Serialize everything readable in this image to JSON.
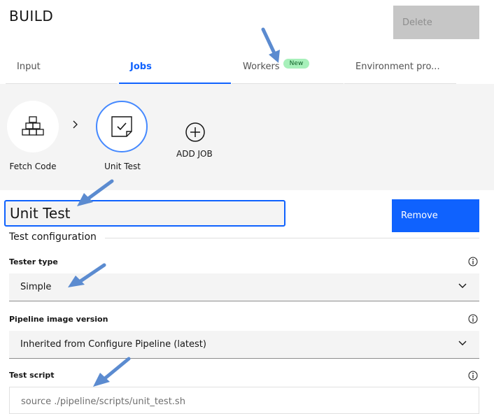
{
  "header": {
    "title": "BUILD",
    "delete_label": "Delete"
  },
  "tabs": [
    {
      "label": "Input",
      "active": false
    },
    {
      "label": "Jobs",
      "active": true
    },
    {
      "label": "Workers",
      "active": false,
      "badge": "New"
    },
    {
      "label": "Environment pro...",
      "active": false
    }
  ],
  "pipeline": {
    "nodes": [
      {
        "label": "Fetch Code",
        "icon": "fetch-code-icon"
      },
      {
        "label": "Unit Test",
        "icon": "unit-test-icon",
        "selected": true
      }
    ],
    "add_job_label": "ADD JOB"
  },
  "job": {
    "name_value": "Unit Test",
    "remove_label": "Remove",
    "section_title": "Test configuration",
    "tester_type": {
      "label": "Tester type",
      "value": "Simple"
    },
    "image_version": {
      "label": "Pipeline image version",
      "value": "Inherited from Configure Pipeline (latest)"
    },
    "test_script": {
      "label": "Test script",
      "value": "source ./pipeline/scripts/unit_test.sh"
    }
  },
  "colors": {
    "accent": "#0f62fe",
    "badge_bg": "#a7f0ba",
    "annotation_arrow": "#5b8bd0"
  }
}
